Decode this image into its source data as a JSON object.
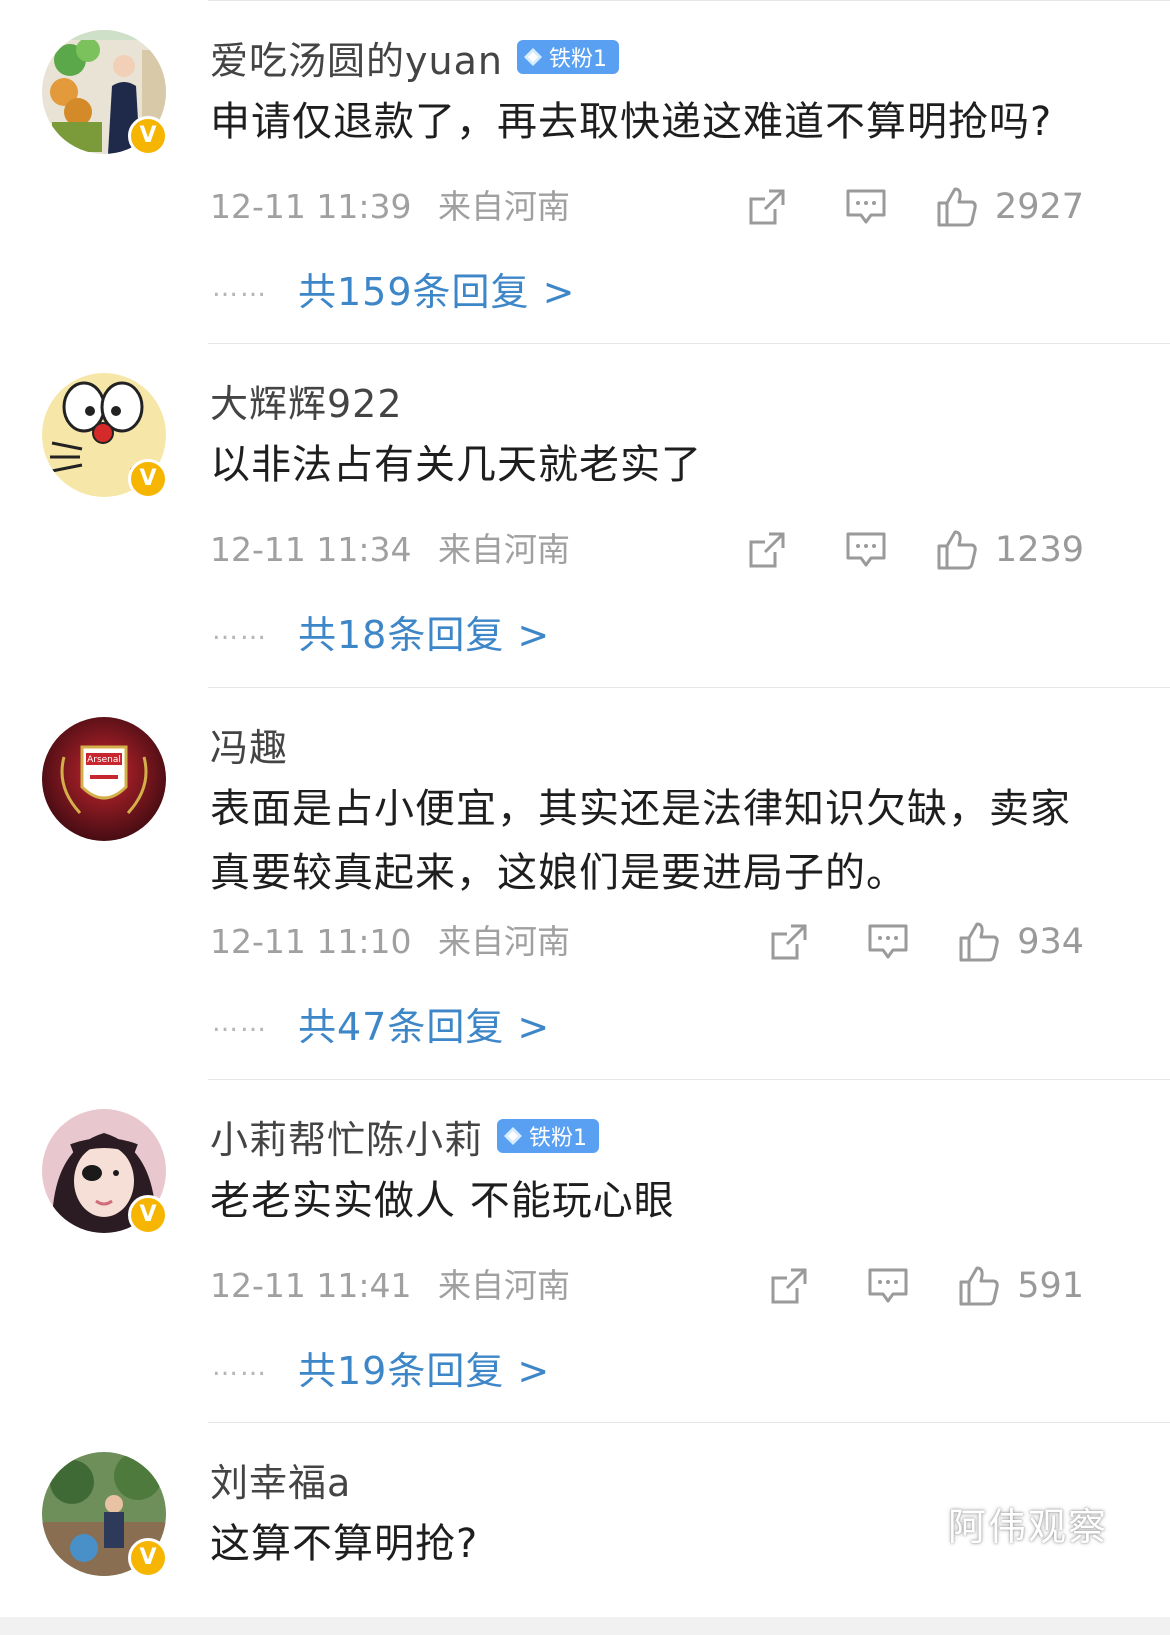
{
  "comments": [
    {
      "username": "爱吃汤圆的yuan",
      "fan_badge": "铁粉1",
      "text": "申请仅退款了，再去取快递这难道不算明抢吗?",
      "time": "12-11 11:39",
      "location": "来自河南",
      "likes": "2927",
      "replies": "共159条回复 >"
    },
    {
      "username": "大辉辉922",
      "fan_badge": "",
      "text": "以非法占有关几天就老实了",
      "time": "12-11 11:34",
      "location": "来自河南",
      "likes": "1239",
      "replies": "共18条回复 >"
    },
    {
      "username": "冯趣",
      "fan_badge": "",
      "text": "表面是占小便宜，其实还是法律知识欠缺，卖家真要较真起来，这娘们是要进局子的。",
      "time": "12-11 11:10",
      "location": "来自河南",
      "likes": "934",
      "replies": "共47条回复 >"
    },
    {
      "username": "小莉帮忙陈小莉",
      "fan_badge": "铁粉1",
      "text": "老老实实做人 不能玩心眼",
      "time": "12-11 11:41",
      "location": "来自河南",
      "likes": "591",
      "replies": "共19条回复 >"
    },
    {
      "username": "刘幸福a",
      "fan_badge": "",
      "text": "这算不算明抢?"
    }
  ],
  "verified_badge": "V",
  "reply_dots": "……",
  "watermark": "阿伟观察",
  "colors": {
    "link_blue": "#3d86c7",
    "verified_yellow": "#f6b500",
    "fan_badge_blue": "#5aa0f2",
    "meta_gray": "#a0a0a0"
  }
}
